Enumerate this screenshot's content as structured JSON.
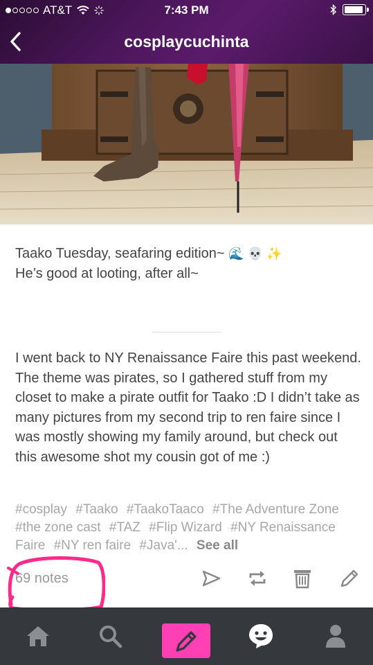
{
  "status_bar": {
    "carrier": "AT&T",
    "time": "7:43 PM",
    "signal_bars_filled": 1,
    "signal_bars_total": 5,
    "battery_level": 0.95
  },
  "nav": {
    "title": "cosplaycuchinta",
    "back_icon": "chevron-left-icon"
  },
  "post": {
    "caption_line1": "Taako Tuesday, seafaring edition~",
    "caption_emojis": "🌊 💀 ✨",
    "caption_line2": "He’s good at looting, after all~",
    "body": "I went back to NY Renaissance Faire this past weekend. The theme was pirates, so I gathered stuff from my closet to make a pirate outfit for Taako :D I didn’t take as many pictures from my second trip to ren faire since I was mostly showing my family around, but check out this awesome shot my cousin got of me :)",
    "tags": [
      "#cosplay",
      "#Taako",
      "#TaakoTaaco",
      "#The Adventure Zone",
      "#the zone cast",
      "#TAZ",
      "#Flip Wizard",
      "#NY Renaissance Faire",
      "#NY ren faire",
      "#Java'..."
    ],
    "see_all": "See all"
  },
  "actions": {
    "notes": "69 notes",
    "icons": [
      "share-icon",
      "reblog-icon",
      "delete-icon",
      "edit-icon"
    ]
  },
  "tabbar": {
    "icons": [
      "home-icon",
      "search-icon",
      "compose-icon",
      "activity-icon",
      "account-icon"
    ],
    "accent": "#ff3fb4"
  },
  "colors": {
    "header": "#4a1659",
    "tabbar": "#35383d",
    "annotation": "#ff2a8a"
  }
}
